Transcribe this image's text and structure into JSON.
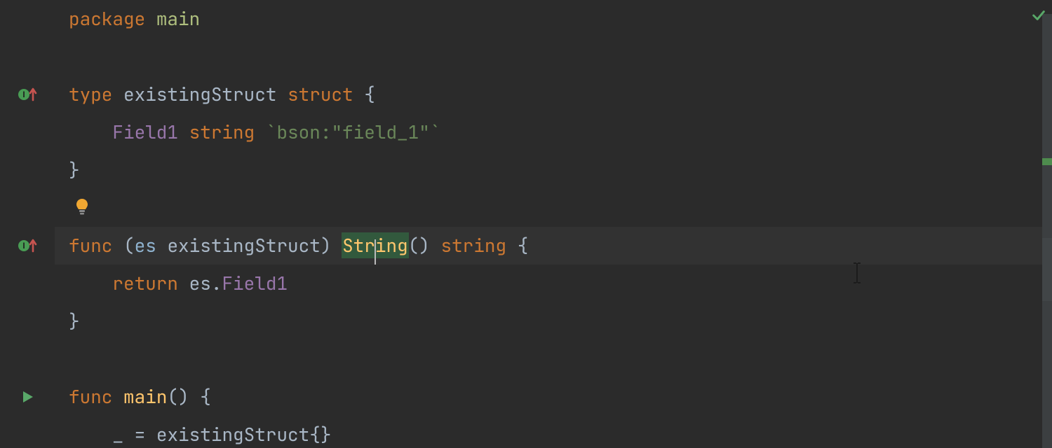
{
  "colors": {
    "background": "#2b2b2b",
    "currentLine": "#323232",
    "keyword": "#cc7832",
    "type": "#b5b6e3",
    "field": "#9876aa",
    "string": "#6a8759",
    "function": "#ffc66d",
    "variable": "#8fb2ce",
    "default": "#a9b7c6",
    "wordHighlight": "#32593d",
    "checkmark": "#59a869"
  },
  "status": {
    "ok_tooltip": "No problems found"
  },
  "gutter": {
    "method_override_tooltip": "Implements method",
    "run_tooltip": "Run",
    "bulb_tooltip": "Intention actions"
  },
  "code": {
    "l1": {
      "package_kw": "package",
      "pkg_name": "main"
    },
    "l2": "",
    "l3": {
      "type_kw": "type",
      "type_name": "existingStruct",
      "struct_kw": "struct",
      "brace_open": "{"
    },
    "l4": {
      "indent": "    ",
      "field_name": "Field1",
      "field_type": "string",
      "tag": "`bson:\"field_1\"`"
    },
    "l5": {
      "brace_close": "}"
    },
    "l6": "",
    "l7": {
      "func_kw": "func",
      "recv_open": "(",
      "recv_name": "es",
      "recv_type": "existingStruct",
      "recv_close": ")",
      "method_name": "String",
      "parens": "()",
      "ret_type": "string",
      "brace_open": "{"
    },
    "l8": {
      "indent": "    ",
      "return_kw": "return",
      "recv_ref": "es",
      "dot": ".",
      "field_ref": "Field1"
    },
    "l9": {
      "brace_close": "}"
    },
    "l10": "",
    "l11": {
      "func_kw": "func",
      "fn_name": "main",
      "parens": "()",
      "brace_open": "{"
    },
    "l12": {
      "indent": "    ",
      "underscore": "_",
      "eq": "=",
      "type_ref": "existingStruct",
      "lit": "{}"
    }
  },
  "highlight": {
    "word": "String",
    "caret_after_chars_in_word": 3
  }
}
